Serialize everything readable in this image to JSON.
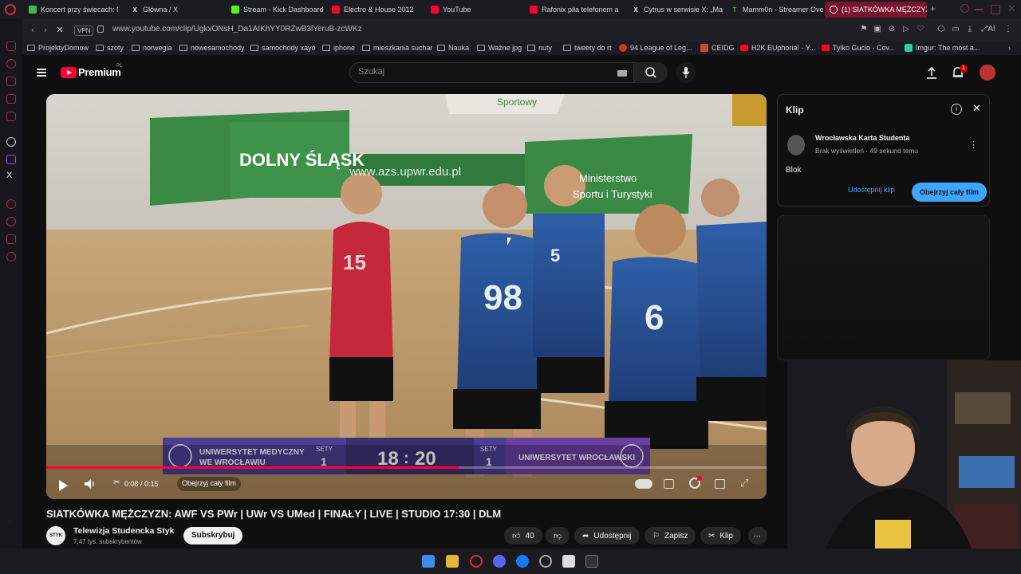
{
  "browser": {
    "tabs": [
      {
        "title": "Koncert przy świecach: M",
        "color": "#3fb950"
      },
      {
        "title": "Główna / X",
        "color": "#ffffff"
      },
      {
        "title": "Stream - Kick Dashboard",
        "color": "#53fc18"
      },
      {
        "title": "Electro & House 2012",
        "color": "#ff0033"
      },
      {
        "title": "YouTube",
        "color": "#ff0033"
      },
      {
        "title": "Rafonix piła telefonem a",
        "color": "#ff0033"
      },
      {
        "title": "Cytrus w serwisie X: „Ma",
        "color": "#ffffff"
      },
      {
        "title": "Mamm0n - Streamer Ove",
        "color": "#3fb950"
      },
      {
        "title": "(1) SIATKÓWKA MĘŻCZYZ",
        "color": "#ff0033"
      }
    ],
    "url": "www.youtube.com/clip/UgkxONsH_Da1AIKhYY0RZwB3lYeruB-zcWKz",
    "vpn_label": "VPN",
    "bookmarks": [
      "ProjektyDomow",
      "szoty",
      "norwegia",
      "nowesamochody",
      "samochody xayo",
      "iphone",
      "mieszkania suchar",
      "Nauka",
      "Ważne jpg",
      "nuty",
      "tweety do rt",
      "94 League of Leg...",
      "CEIDG",
      "H2K EUphoria! - Y...",
      "Tylko Gucio - Cov...",
      "Imgur: The most a..."
    ]
  },
  "youtube": {
    "brand": "Premium",
    "region": "PL",
    "search_placeholder": "Szukaj",
    "notifications_count": "1",
    "video": {
      "home_team": "UNIWERSYTET MEDYCZNY WE WROCŁAWIU",
      "home_team_line1": "UNIWERSYTET MEDYCZNY",
      "home_team_line2": "WE WROCŁAWIU",
      "away_team": "UNIWERSYTET WROCŁAWSKI",
      "sets_label": "SETY",
      "home_sets": "1",
      "away_sets": "1",
      "home_points": "18",
      "away_points": "20",
      "score_separator": ":",
      "banner_left": "DOLNY ŚLĄSK",
      "banner_url": "www.azs.upwr.edu.pl",
      "banner_right_1": "Ministerstwo",
      "banner_right_2": "Sportu i Turystyki",
      "banner_top": "Sportowy",
      "jerseys": [
        "15",
        "98",
        "5",
        "6"
      ],
      "jersey_text": "UNIWERSYTET MEDYCZNY",
      "time": "0:08 / 0:15",
      "progress": 0.573,
      "clip_button": "Obejrzyj cały film"
    },
    "title": "SIATKÓWKA MĘŻCZYZN: AWF VS PWr | UWr VS UMed | FINAŁY | LIVE | STUDIO 17:30 | DLM",
    "channel": {
      "name": "Telewizja Studencka Styk",
      "subscribers": "7,47 tys. subskrybentów",
      "avatar_text": "STYK",
      "subscribe": "Subskrybuj"
    },
    "actions": {
      "likes": "40",
      "share": "Udostępnij",
      "save": "Zapisz",
      "clip": "Klip"
    },
    "clip_panel": {
      "title": "Klip",
      "author": "Wrocławska Karta Studenta",
      "meta": "Brak wyświetleń · 49 sekund temu",
      "clip_name": "Blok",
      "share_clip": "Udostępnij klip",
      "watch_full": "Obejrzyj cały film"
    }
  },
  "colors": {
    "youtube_red": "#ff0033",
    "accent_blue": "#3ea6ff",
    "opera_red": "#e3243b",
    "score_purple": "#5a2a8c"
  }
}
